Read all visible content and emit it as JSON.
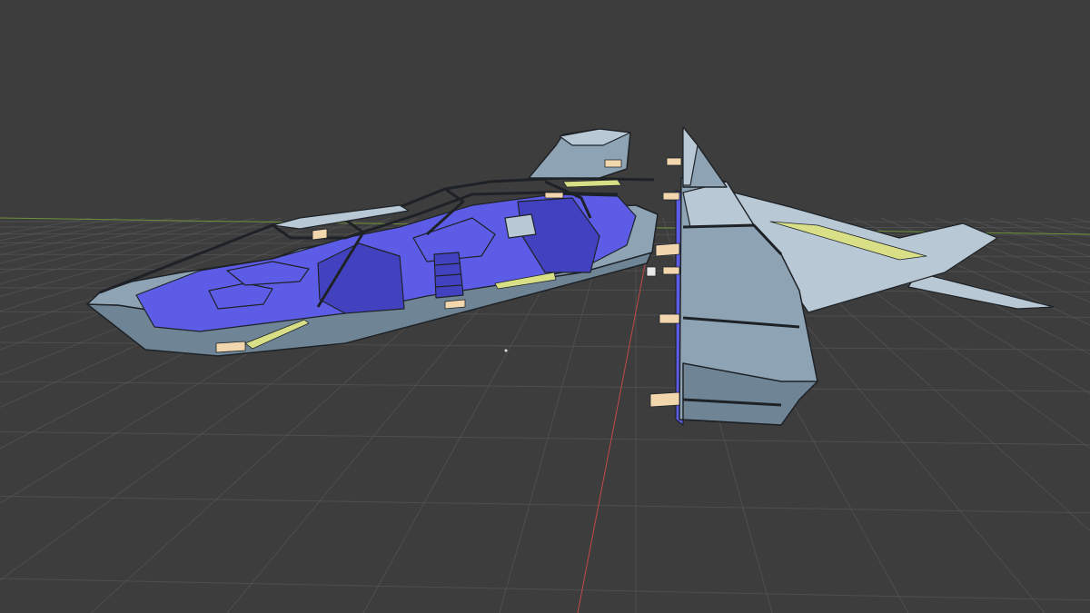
{
  "viewport": {
    "background_color": "#3d3d3d",
    "horizon_color": "#4a4a4a",
    "grid_color": "#5a5a5a",
    "x_axis_color": "#c24a4a",
    "y_axis_color": "#6f8f3a"
  },
  "model": {
    "hull_color": "#8ea4b4",
    "hull_shadow_color": "#6f8596",
    "hull_highlight_color": "#b8c8d4",
    "interior_color": "#5c5ce6",
    "interior_dark_color": "#4242c0",
    "stripe_color": "#d8df86",
    "connector_color": "#f1d6ae",
    "edge_color": "#1e2227"
  }
}
